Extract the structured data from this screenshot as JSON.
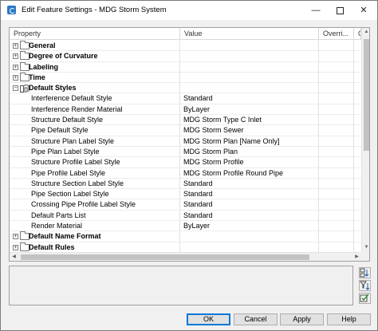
{
  "window": {
    "title": "Edit Feature Settings - MDG Storm System",
    "controls": {
      "minimize": "—",
      "close": "✕"
    }
  },
  "grid": {
    "columns": [
      "Property",
      "Value",
      "Overri...",
      "C"
    ],
    "rows": [
      {
        "type": "category",
        "expander": "+",
        "icon": "folder-icon",
        "label": "General",
        "value": ""
      },
      {
        "type": "category",
        "expander": "+",
        "icon": "folder-icon",
        "label": "Degree of Curvature",
        "value": ""
      },
      {
        "type": "category",
        "expander": "+",
        "icon": "folder-icon",
        "label": "Labeling",
        "value": ""
      },
      {
        "type": "category",
        "expander": "+",
        "icon": "folder-icon",
        "label": "Time",
        "value": ""
      },
      {
        "type": "category",
        "expander": "−",
        "icon": "styles-icon",
        "label": "Default Styles",
        "value": ""
      },
      {
        "type": "child",
        "label": "Interference Default Style",
        "value": "Standard"
      },
      {
        "type": "child",
        "label": "Interference Render Material",
        "value": "ByLayer"
      },
      {
        "type": "child",
        "label": "Structure Default Style",
        "value": "MDG Storm Type C Inlet"
      },
      {
        "type": "child",
        "label": "Pipe Default Style",
        "value": "MDG Storm Sewer"
      },
      {
        "type": "child",
        "label": "Structure Plan Label Style",
        "value": "MDG Storm Plan [Name Only]"
      },
      {
        "type": "child",
        "label": "Pipe Plan Label Style",
        "value": "MDG Storm Plan"
      },
      {
        "type": "child",
        "label": "Structure Profile Label Style",
        "value": "MDG Storm Profile"
      },
      {
        "type": "child",
        "label": "Pipe Profile Label Style",
        "value": "MDG Storm Profile Round Pipe"
      },
      {
        "type": "child",
        "label": "Structure Section Label Style",
        "value": "Standard"
      },
      {
        "type": "child",
        "label": "Pipe Section Label Style",
        "value": "Standard"
      },
      {
        "type": "child",
        "label": "Crossing Pipe Profile Label Style",
        "value": "Standard"
      },
      {
        "type": "child",
        "label": "Default Parts List",
        "value": "Standard"
      },
      {
        "type": "child",
        "label": "Render Material",
        "value": "ByLayer"
      },
      {
        "type": "category",
        "expander": "+",
        "icon": "folder-icon",
        "label": "Default Name Format",
        "value": ""
      },
      {
        "type": "category",
        "expander": "+",
        "icon": "folder-icon",
        "label": "Default Rules",
        "value": ""
      }
    ]
  },
  "buttons": {
    "ok": "OK",
    "cancel": "Cancel",
    "apply": "Apply",
    "help": "Help"
  },
  "side_tools": [
    "sort-categorized-icon",
    "sort-filter-icon",
    "check-all-icon"
  ],
  "colors": {
    "accent": "#0078d7",
    "app_icon": "#2b79c2",
    "grid_line": "#e0e0e0"
  }
}
